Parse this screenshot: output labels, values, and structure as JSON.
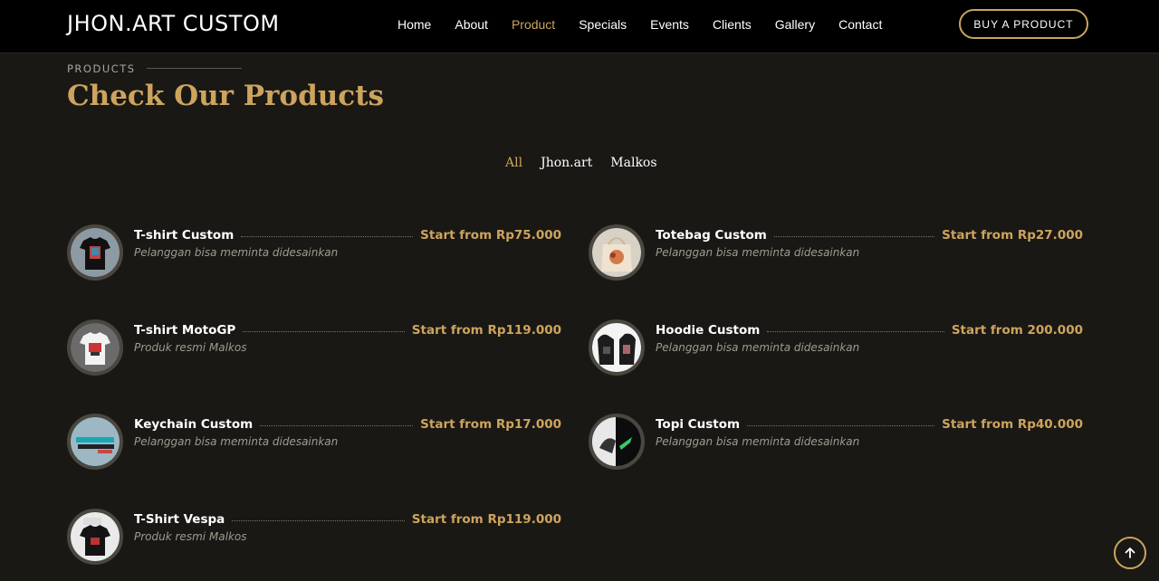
{
  "header": {
    "logo": "JHON.ART CUSTOM",
    "nav": [
      {
        "label": "Home",
        "active": false
      },
      {
        "label": "About",
        "active": false
      },
      {
        "label": "Product",
        "active": true
      },
      {
        "label": "Specials",
        "active": false
      },
      {
        "label": "Events",
        "active": false
      },
      {
        "label": "Clients",
        "active": false
      },
      {
        "label": "Gallery",
        "active": false
      },
      {
        "label": "Contact",
        "active": false
      }
    ],
    "buy_button": "BUY A PRODUCT"
  },
  "section": {
    "label": "PRODUCTS",
    "title": "Check Our Products"
  },
  "filters": [
    {
      "label": "All",
      "active": true
    },
    {
      "label": "Jhon.art",
      "active": false
    },
    {
      "label": "Malkos",
      "active": false
    }
  ],
  "products": [
    {
      "name": "T-shirt Custom",
      "price": "Start from Rp75.000",
      "desc": "Pelanggan bisa meminta didesainkan",
      "thumb": "tshirt-black-icon"
    },
    {
      "name": "Totebag Custom",
      "price": "Start from Rp27.000",
      "desc": "Pelanggan bisa meminta didesainkan",
      "thumb": "totebag-icon"
    },
    {
      "name": "T-shirt MotoGP",
      "price": "Start from Rp119.000",
      "desc": "Produk resmi Malkos",
      "thumb": "tshirt-white-icon"
    },
    {
      "name": "Hoodie Custom",
      "price": "Start from 200.000",
      "desc": "Pelanggan bisa meminta didesainkan",
      "thumb": "hoodie-icon"
    },
    {
      "name": "Keychain Custom",
      "price": "Start from Rp17.000",
      "desc": "Pelanggan bisa meminta didesainkan",
      "thumb": "keychain-icon"
    },
    {
      "name": "Topi Custom",
      "price": "Start from Rp40.000",
      "desc": "Pelanggan bisa meminta didesainkan",
      "thumb": "cap-icon"
    },
    {
      "name": "T-Shirt Vespa",
      "price": "Start from Rp119.000",
      "desc": "Produk resmi Malkos",
      "thumb": "tshirt-vespa-icon"
    }
  ],
  "colors": {
    "accent": "#cda45e",
    "background": "#1a1814",
    "header_bg": "#000000"
  }
}
